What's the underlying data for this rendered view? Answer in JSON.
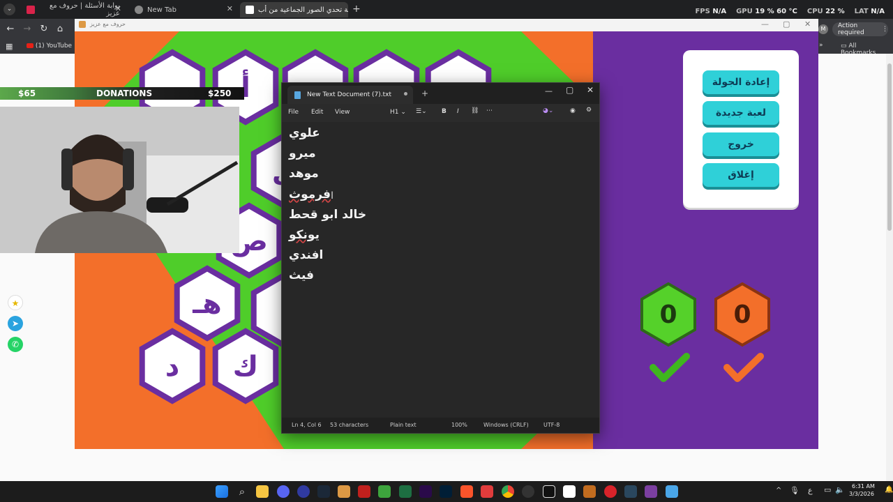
{
  "browser": {
    "tabs": [
      {
        "label": "بوابة الأسئلة | حروف مع عزيز"
      },
      {
        "label": "New Tab"
      },
      {
        "label": "لعبة تحدي الصور الجماعية من أب"
      }
    ],
    "new_tab_symbol": "+",
    "game_window_title": "حروف مع عزيز",
    "action_required": "Action required",
    "bookmark_youtube": "(1) YouTube",
    "all_bookmarks": "All Bookmarks",
    "profile_initial": "M"
  },
  "overlay": {
    "fps_label": "FPS",
    "fps_value": "N/A",
    "gpu_label": "GPU",
    "gpu_value": "19 % 60 °C",
    "cpu_label": "CPU",
    "cpu_value": "22 %",
    "lat_label": "LAT",
    "lat_value": "N/A"
  },
  "stream": {
    "donation_left": "$65",
    "donation_title": "DONATIONS",
    "donation_right": "$250"
  },
  "game": {
    "letters_visible": [
      "أ",
      "ل",
      "ص",
      "هـ",
      "د",
      "ك"
    ],
    "menu": {
      "restart": "إعادة الجولة",
      "new_game": "لعبة جديدة",
      "exit": "خروج",
      "close": "إغلاق"
    },
    "score_green": "0",
    "score_orange": "0",
    "colors": {
      "green": "#4fcd2a",
      "orange": "#f36f2a",
      "purple": "#6a2ea0",
      "button": "#2fd0d8"
    }
  },
  "notepad": {
    "tab_title": "New Text Document (7).txt",
    "menu": {
      "file": "File",
      "edit": "Edit",
      "view": "View",
      "heading": "H1"
    },
    "lines": [
      "علوي",
      "ميرو",
      "موهد",
      "فرموث",
      "خالد ابو قحط",
      "يونكو",
      "افندي",
      "فيث"
    ],
    "status": {
      "position": "Ln 4, Col 6",
      "characters": "53 characters",
      "format": "Plain text",
      "zoom": "100%",
      "line_ending": "Windows (CRLF)",
      "encoding": "UTF-8"
    }
  },
  "taskbar": {
    "time": "6:31 AM",
    "date": "3/3/2026",
    "lang": "ع"
  }
}
